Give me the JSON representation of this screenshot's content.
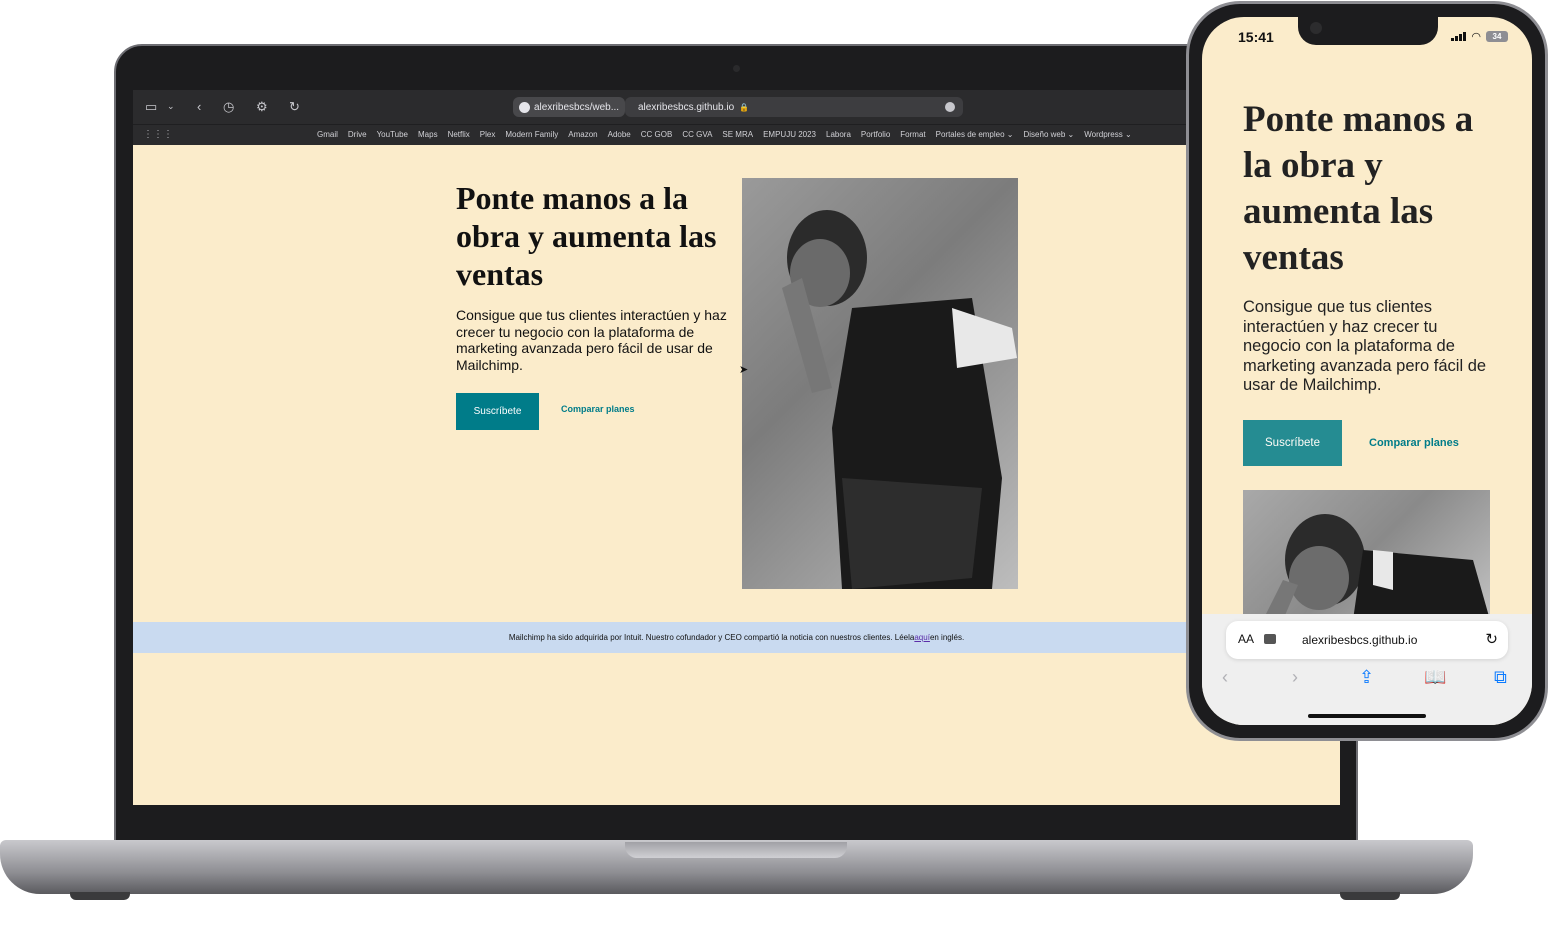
{
  "laptop": {
    "tabs": [
      {
        "label": "alexribesbcs/web..."
      }
    ],
    "url": "alexribesbcs.github.io",
    "bookmarks": [
      "Gmail",
      "Drive",
      "YouTube",
      "Maps",
      "Netflix",
      "Plex",
      "Modern Family",
      "Amazon",
      "Adobe",
      "CC GOB",
      "CC GVA",
      "SE MRA",
      "EMPUJU 2023",
      "Labora",
      "Portfolio",
      "Format",
      "Portales de empleo ⌄",
      "Diseño web ⌄",
      "Wordpress ⌄"
    ],
    "page": {
      "title": "Ponte manos a la obra y aumenta las ventas",
      "subtitle": "Consigue que tus clientes interactúen y haz crecer tu negocio con la plataforma de marketing avanzada pero fácil de usar de Mailchimp.",
      "primary_button": "Suscríbete",
      "secondary_link": "Comparar planes",
      "notice_before": "Mailchimp ha sido adquirida por Intuit. Nuestro cofundador y CEO compartió la noticia con nuestros clientes. Léela ",
      "notice_link": "aquí",
      "notice_after": " en inglés."
    }
  },
  "phone": {
    "time": "15:41",
    "battery": "34",
    "page": {
      "title": "Ponte manos a la obra y aumenta las ventas",
      "subtitle": "Consigue que tus clientes interactúen y haz crecer tu negocio con la plataforma de marketing avanzada pero fácil de usar de Mailchimp.",
      "primary_button": "Suscríbete",
      "secondary_link": "Comparar planes"
    },
    "address_bar": {
      "text_size": "AA",
      "url": "alexribesbcs.github.io"
    }
  },
  "colors": {
    "page_bg": "#fbeccb",
    "accent": "#007c89",
    "notice_bg": "#c9daf0",
    "safari_dark": "#2b2b2d"
  }
}
